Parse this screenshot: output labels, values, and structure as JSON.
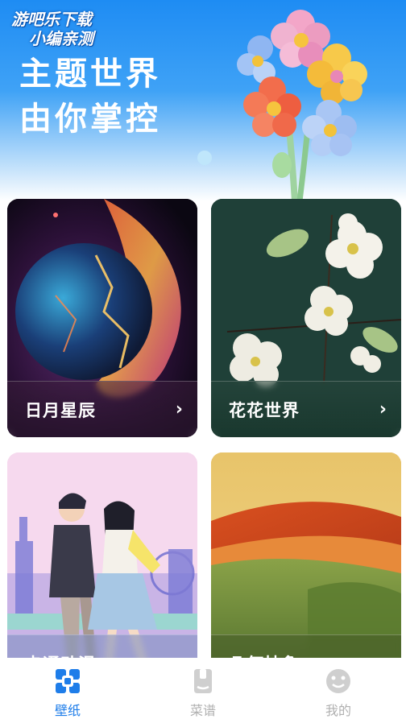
{
  "watermark": {
    "line1": "游吧乐下载",
    "line2": "小编亲测"
  },
  "hero": {
    "title_line1": "主题世界",
    "title_line2": "由你掌控"
  },
  "categories": [
    {
      "label": "日月星辰"
    },
    {
      "label": "花花世界"
    },
    {
      "label": "卡通动漫"
    },
    {
      "label": "几何抽象"
    }
  ],
  "tabs": [
    {
      "label": "壁纸",
      "icon": "wallpaper-grid-icon",
      "active": true
    },
    {
      "label": "菜谱",
      "icon": "recipe-icon",
      "active": false
    },
    {
      "label": "我的",
      "icon": "profile-icon",
      "active": false
    }
  ],
  "colors": {
    "accent": "#1e7de9",
    "hero_top": "#1e8cf3",
    "tab_inactive": "#b0b0b0"
  }
}
